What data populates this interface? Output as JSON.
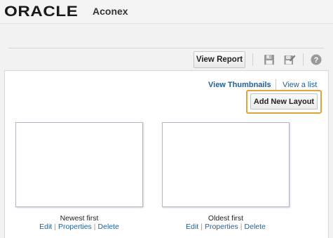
{
  "header": {
    "logo_text": "ORACLE",
    "product_name": "Aconex"
  },
  "toolbar": {
    "view_report_label": "View Report",
    "icons": [
      "save-icon",
      "save-as-icon",
      "help-icon"
    ]
  },
  "view_options": {
    "thumbnails_label": "View Thumbnails",
    "list_label": "View a list"
  },
  "add_layout_label": "Add New Layout",
  "layouts": [
    {
      "title": "Newest first",
      "actions": [
        "Edit",
        "Properties",
        "Delete"
      ]
    },
    {
      "title": "Oldest first",
      "actions": [
        "Edit",
        "Properties",
        "Delete"
      ]
    }
  ],
  "colors": {
    "link": "#1f5f99",
    "highlight": "#e3a23a"
  }
}
